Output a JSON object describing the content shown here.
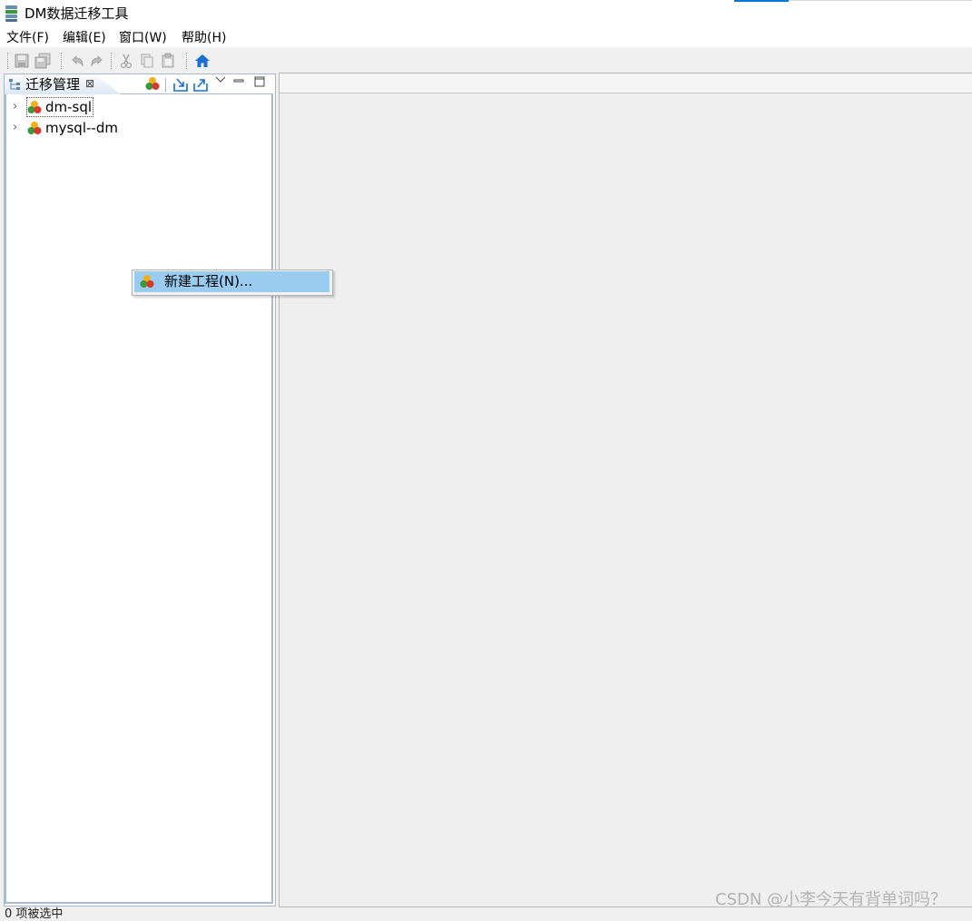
{
  "window": {
    "title": "DM数据迁移工具"
  },
  "menubar": {
    "items": [
      {
        "label": "文件(F)"
      },
      {
        "label": "编辑(E)"
      },
      {
        "label": "窗口(W)"
      },
      {
        "label": "帮助(H)"
      }
    ]
  },
  "toolbar": {
    "icons": [
      "save-icon",
      "save-all-icon",
      "undo-icon",
      "redo-icon",
      "cut-icon",
      "copy-icon",
      "paste-icon",
      "home-icon"
    ],
    "accent_color": "#1a6fd0"
  },
  "left_panel": {
    "tab_label": "迁移管理",
    "tab_close": "⊠",
    "tree": [
      {
        "label": "dm-sql",
        "focused": true
      },
      {
        "label": "mysql--dm",
        "focused": false
      }
    ]
  },
  "context_menu": {
    "items": [
      {
        "label": "新建工程(N)...",
        "highlighted": true
      }
    ],
    "highlight_color": "#99ccf0"
  },
  "status": {
    "text": "0 项被选中"
  },
  "watermark": "CSDN @小李今天有背单词吗？"
}
